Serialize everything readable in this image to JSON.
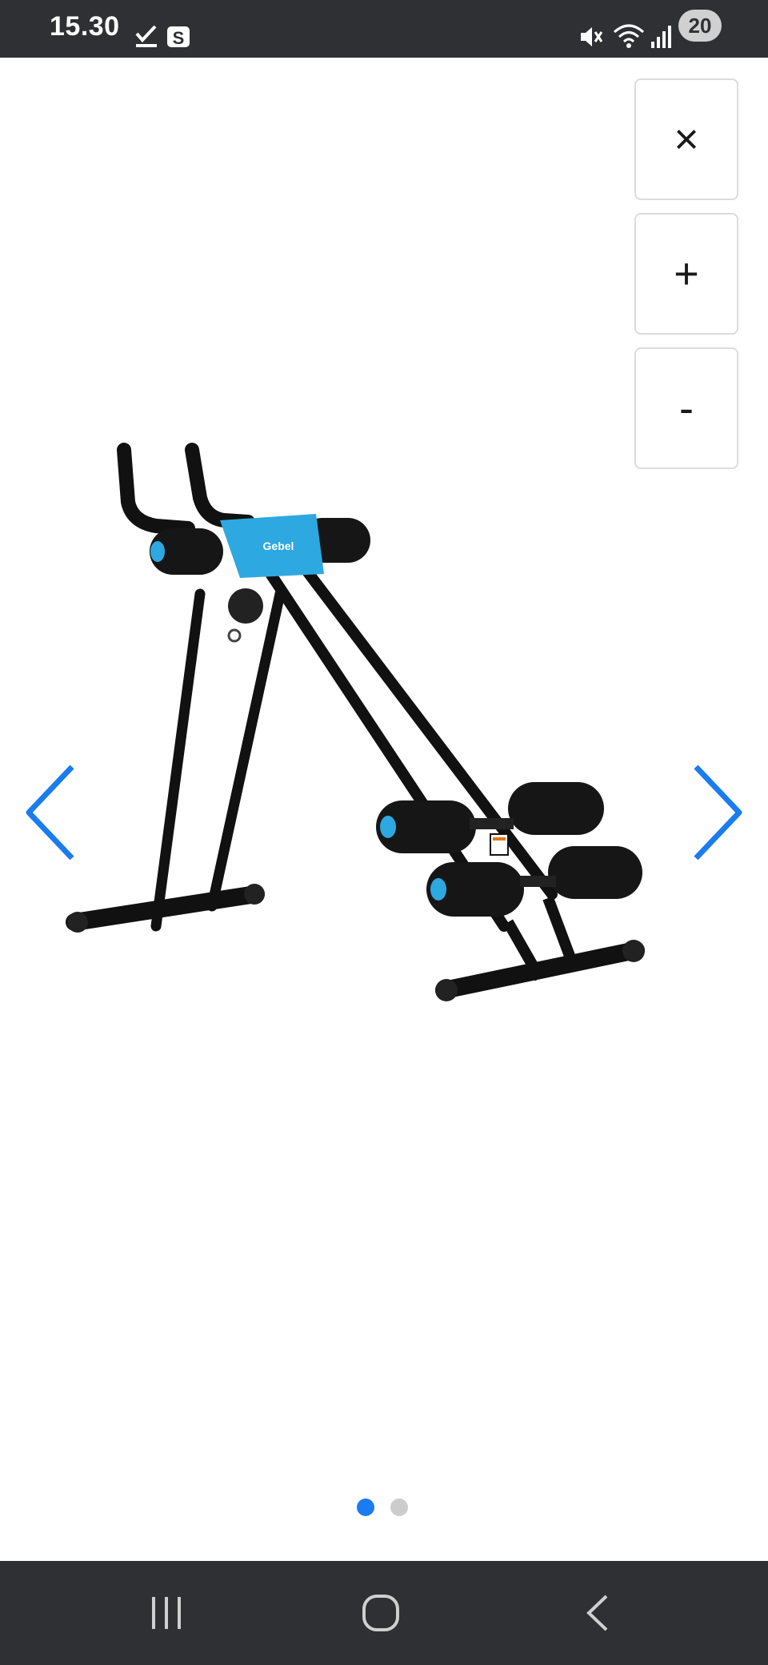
{
  "status_bar": {
    "time": "15.30",
    "battery_level": "20",
    "icons": [
      "check-download-icon",
      "s-app-icon",
      "mute-icon",
      "wifi-icon",
      "signal-icon"
    ]
  },
  "viewer": {
    "controls": {
      "close_label": "×",
      "zoom_in_label": "+",
      "zoom_out_label": "-"
    },
    "image": {
      "brand_text": "Gebel",
      "accent_color": "#2ea8e0"
    },
    "pagination": {
      "current": 1,
      "total": 2
    },
    "nav_color": "#1a7cf0"
  },
  "nav_bar": {
    "buttons": [
      "recent-apps-icon",
      "home-icon",
      "back-icon"
    ]
  }
}
